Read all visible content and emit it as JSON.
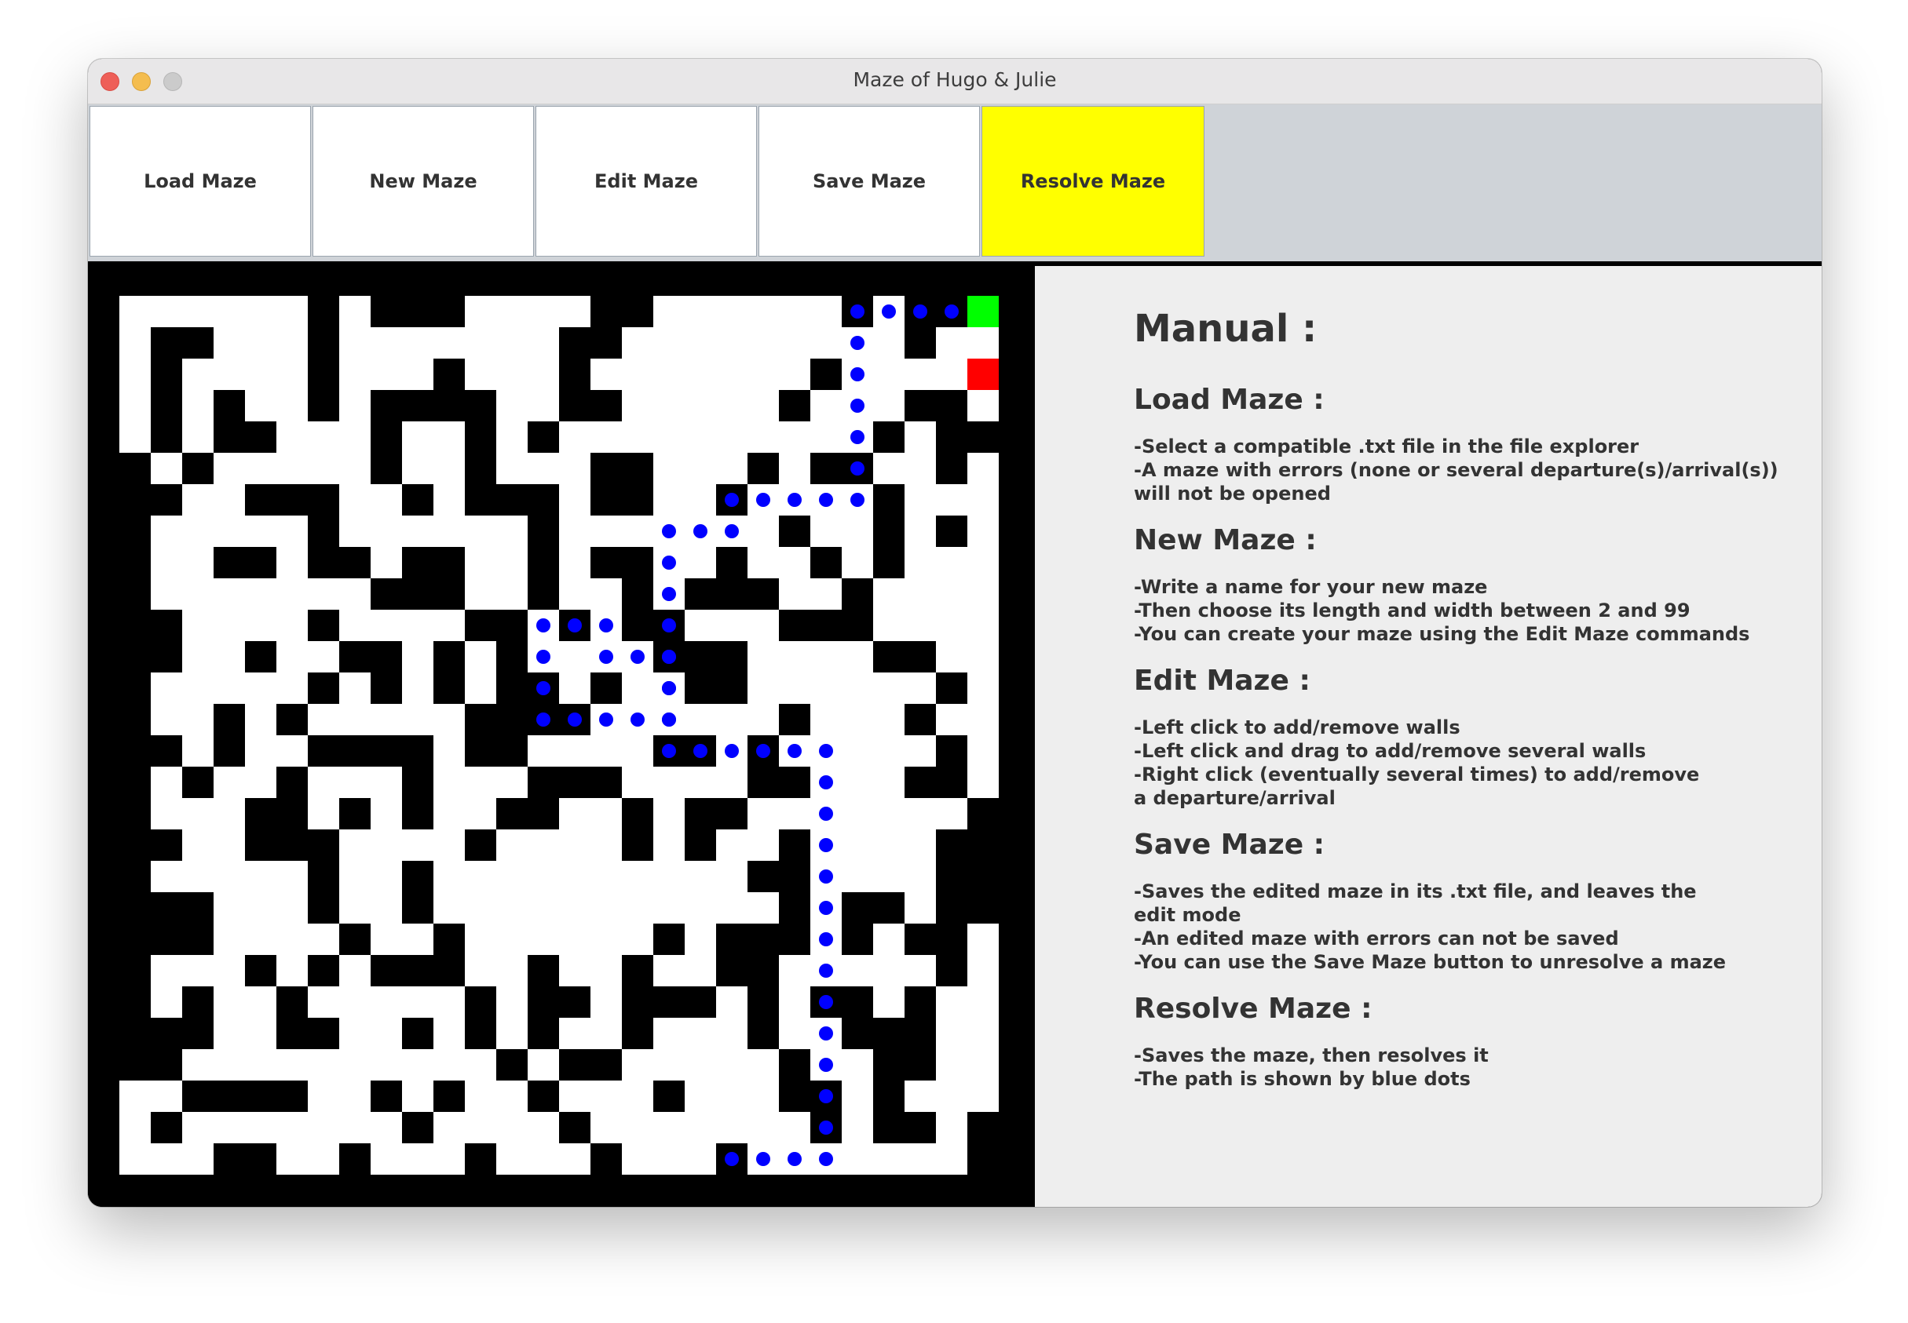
{
  "window": {
    "title": "Maze of Hugo & Julie"
  },
  "toolbar": {
    "buttons": [
      {
        "label": "Load Maze"
      },
      {
        "label": "New Maze"
      },
      {
        "label": "Edit Maze"
      },
      {
        "label": "Save Maze"
      },
      {
        "label": "Resolve Maze",
        "highlight_color": "#ffff00"
      }
    ]
  },
  "colors": {
    "wall": "#000000",
    "path": "#ffffff",
    "solution_dot": "#0000ff",
    "departure": "#00ff00",
    "arrival": "#ff0000",
    "manual_bg": "#eeeeee"
  },
  "maze": {
    "rows": 28,
    "cols": 28,
    "grid": [
      "......#.###....##......#.##.",
      ".##...#.......##.........#..",
      ".#....#...#...#.......#.....",
      ".#.#..#.####..##.....#...##.",
      ".#.##...#..#.#..........#.##",
      "#.#.....#..#...##...#.##..#.",
      "##..###..#.###.##..#....#...",
      "#.....#......#.......#..#.#.",
      "#..##.##.##..#.##..#..#.#...",
      "#.......###..#..#.###..#....",
      "##....#....##.#.##...###....",
      "##..#..##.#.#....###....##..",
      "#.....#.#.#.##.#..##......#.",
      "#..#.#.....####......#...#..",
      "##.#..####.##....##.#.....#.",
      "#.#..#...#...###....##...##.",
      "#...##.#.#..##..#.##.......#",
      "##..###....#....#.#..#....##",
      "#.....#..#..........##....##",
      "###...#..#...........#.##.##",
      "###....#..#......#.###.#.##.",
      "#...#.#.###..#..#..##.....#.",
      "#.#..#.....#.##.###.#.##.#..",
      "###..##..#.#.#..#...#..###..",
      "##..........#.##.....#..##..",
      "..####..#.#..#...#...##.#...",
      ".#.......#....#.......#.##.#",
      "...##..#...#...#...#.......#"
    ],
    "solution_path": [
      [
        0,
        27
      ],
      [
        0,
        26
      ],
      [
        0,
        25
      ],
      [
        0,
        24
      ],
      [
        0,
        23
      ],
      [
        1,
        23
      ],
      [
        2,
        23
      ],
      [
        3,
        23
      ],
      [
        4,
        23
      ],
      [
        5,
        23
      ],
      [
        6,
        23
      ],
      [
        6,
        22
      ],
      [
        6,
        21
      ],
      [
        6,
        20
      ],
      [
        6,
        19
      ],
      [
        7,
        19
      ],
      [
        7,
        18
      ],
      [
        7,
        17
      ],
      [
        8,
        17
      ],
      [
        9,
        17
      ],
      [
        10,
        17
      ],
      [
        11,
        17
      ],
      [
        12,
        17
      ],
      [
        13,
        17
      ],
      [
        13,
        16
      ],
      [
        13,
        15
      ],
      [
        13,
        14
      ],
      [
        13,
        13
      ],
      [
        12,
        13
      ],
      [
        11,
        13
      ],
      [
        10,
        13
      ],
      [
        10,
        14
      ],
      [
        10,
        15
      ],
      [
        11,
        15
      ],
      [
        11,
        16
      ],
      [
        11,
        17
      ],
      [
        12,
        17
      ],
      [
        13,
        17
      ],
      [
        14,
        17
      ],
      [
        14,
        18
      ],
      [
        14,
        19
      ],
      [
        14,
        20
      ],
      [
        14,
        21
      ],
      [
        14,
        22
      ],
      [
        15,
        22
      ],
      [
        16,
        22
      ],
      [
        17,
        22
      ],
      [
        18,
        22
      ],
      [
        19,
        22
      ],
      [
        20,
        22
      ],
      [
        21,
        22
      ],
      [
        22,
        22
      ],
      [
        23,
        22
      ],
      [
        24,
        22
      ],
      [
        25,
        22
      ],
      [
        26,
        22
      ],
      [
        27,
        22
      ],
      [
        27,
        21
      ],
      [
        27,
        20
      ],
      [
        27,
        19
      ]
    ],
    "departure": [
      0,
      27
    ],
    "arrival": [
      2,
      27
    ]
  },
  "manual": {
    "title": "Manual :",
    "sections": [
      {
        "title": "Load Maze :",
        "lines": [
          "-Select a compatible .txt file in the file explorer",
          "-A maze with errors (none or several departure(s)/arrival(s))",
          "will not be opened"
        ]
      },
      {
        "title": "New Maze :",
        "lines": [
          "-Write a name for your new maze",
          "-Then choose its length and width between 2 and 99",
          "-You can create your maze using the Edit Maze commands"
        ]
      },
      {
        "title": "Edit Maze :",
        "lines": [
          "-Left click to add/remove walls",
          "-Left click and drag to add/remove several walls",
          "-Right click (eventually several times) to add/remove",
          "a departure/arrival"
        ]
      },
      {
        "title": "Save Maze :",
        "lines": [
          "-Saves the edited maze in its .txt file, and leaves the",
          "edit mode",
          "-An edited maze with errors can not be saved",
          "-You can use the Save Maze button to unresolve a maze"
        ]
      },
      {
        "title": "Resolve Maze :",
        "lines": [
          "-Saves the maze, then resolves it",
          "-The path is shown by blue dots"
        ]
      }
    ]
  }
}
